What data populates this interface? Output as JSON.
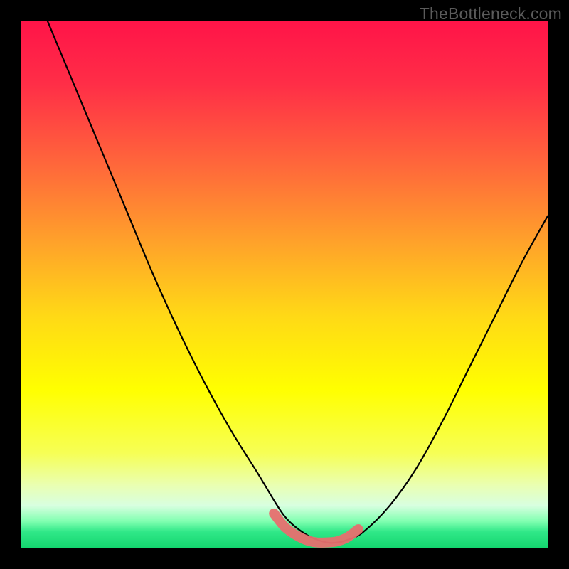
{
  "watermark": "TheBottleneck.com",
  "colors": {
    "frame": "#000000",
    "curve": "#000000",
    "highlight": "#e76f6f",
    "gradient_stops": [
      {
        "pct": 0,
        "color": "#ff1448"
      },
      {
        "pct": 12,
        "color": "#ff2e47"
      },
      {
        "pct": 28,
        "color": "#ff6a3a"
      },
      {
        "pct": 42,
        "color": "#ffa22a"
      },
      {
        "pct": 56,
        "color": "#ffd916"
      },
      {
        "pct": 70,
        "color": "#ffff00"
      },
      {
        "pct": 82,
        "color": "#f6ff55"
      },
      {
        "pct": 88,
        "color": "#eaffb0"
      },
      {
        "pct": 92,
        "color": "#d8ffe0"
      },
      {
        "pct": 95,
        "color": "#80ffb0"
      },
      {
        "pct": 97,
        "color": "#30e888"
      },
      {
        "pct": 100,
        "color": "#14d66f"
      }
    ]
  },
  "chart_data": {
    "type": "line",
    "title": "",
    "xlabel": "",
    "ylabel": "",
    "xlim": [
      0,
      100
    ],
    "ylim": [
      0,
      100
    ],
    "series": [
      {
        "name": "bottleneck-curve",
        "x": [
          5,
          10,
          15,
          20,
          25,
          30,
          35,
          40,
          45,
          48,
          50,
          52,
          55,
          58,
          60,
          62,
          65,
          70,
          75,
          80,
          85,
          90,
          95,
          100
        ],
        "values": [
          100,
          88,
          76,
          64,
          52,
          41,
          31,
          22,
          14,
          9,
          6,
          4,
          2,
          1,
          1,
          1.5,
          3,
          8,
          15,
          24,
          34,
          44,
          54,
          63
        ]
      }
    ],
    "highlight": {
      "name": "optimal-zone",
      "x": [
        48,
        50,
        52,
        54,
        56,
        58,
        60,
        62,
        64
      ],
      "values": [
        6.5,
        4,
        2.5,
        1.5,
        1,
        1,
        1.2,
        2,
        3.5
      ]
    }
  }
}
